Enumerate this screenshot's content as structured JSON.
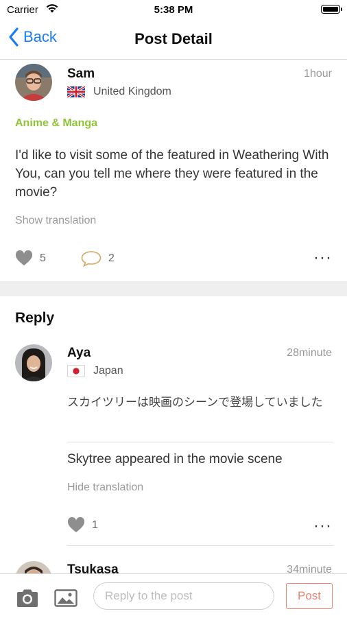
{
  "status_bar": {
    "carrier": "Carrier",
    "time": "5:38 PM"
  },
  "nav": {
    "back_label": "Back",
    "title": "Post Detail"
  },
  "post": {
    "author": "Sam",
    "time": "1hour",
    "country": "United Kingdom",
    "category": "Anime & Manga",
    "category_color": "#8fc33a",
    "text": "I'd like to visit some of the featured in Weathering With You, can you tell me  where they were featured in the movie?",
    "translation_toggle": "Show translation",
    "likes": "5",
    "comments": "2",
    "more": "···"
  },
  "reply_section": {
    "heading": "Reply",
    "replies": [
      {
        "author": "Aya",
        "time": "28minute",
        "country": "Japan",
        "text": "スカイツリーは映画のシーンで登場していました",
        "translation": "Skytree appeared in the movie scene",
        "translation_toggle": "Hide translation",
        "likes": "1",
        "more": "···"
      },
      {
        "author": "Tsukasa",
        "time": "34minute"
      }
    ]
  },
  "composer": {
    "placeholder": "Reply to the post",
    "post_label": "Post",
    "accent_color": "#e8836f"
  },
  "icons": [
    "wifi-icon",
    "battery-icon",
    "back-chevron-icon",
    "heart-icon",
    "comment-icon",
    "more-icon",
    "camera-icon",
    "image-icon",
    "uk-flag-icon",
    "japan-flag-icon"
  ]
}
